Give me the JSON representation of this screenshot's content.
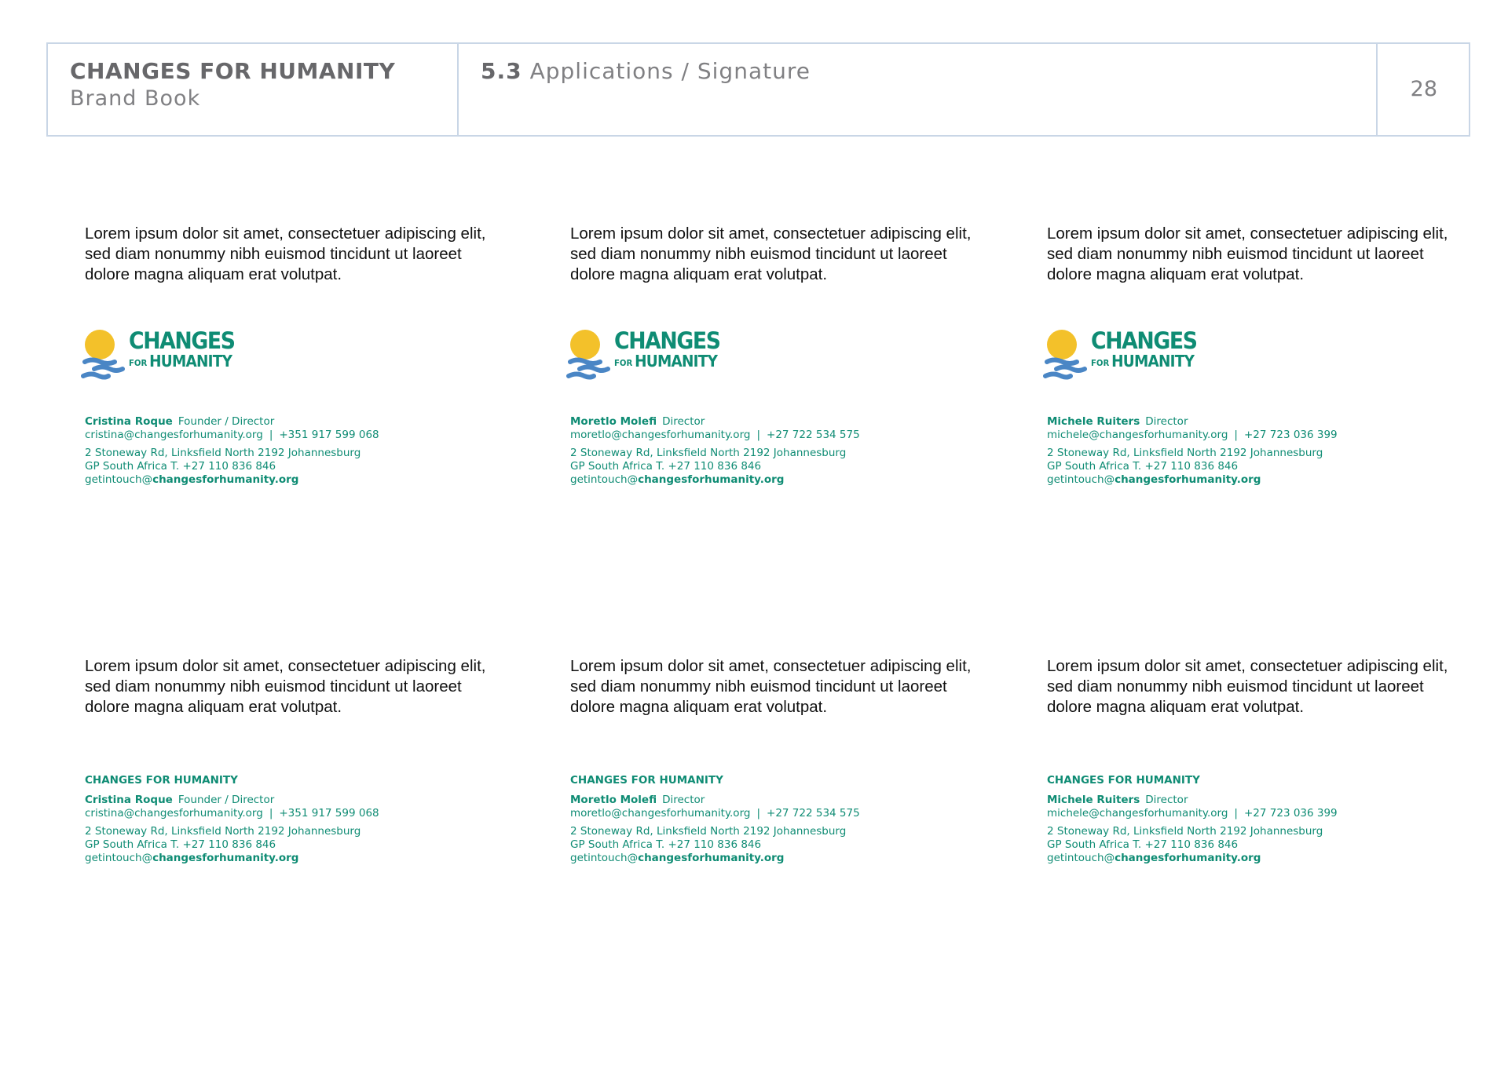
{
  "header": {
    "brand_name": "CHANGES FOR HUMANITY",
    "brand_sub": "Brand Book",
    "section_number": "5.3",
    "section_title": "Applications / Signature",
    "page_number": "28"
  },
  "logo": {
    "word_changes": "CHANGES",
    "word_for": "FOR",
    "word_humanity": "HUMANITY",
    "sun_color": "#f3c12a",
    "water_color": "#4a86c5",
    "text_color": "#0f8c74"
  },
  "lorem": "Lorem ipsum dolor sit amet, consectetuer adipiscing elit, sed diam nonummy nibh euismod tincidunt ut laoreet dolore magna aliquam erat volutpat.",
  "text_org": "CHANGES FOR HUMANITY",
  "address": {
    "line1": "2 Stoneway Rd, Linksfield North  2192 Johannesburg",
    "line2": "GP  South Africa  T. +27 110 836 846",
    "email_prefix": "getintouch@",
    "email_domain": "changesforhumanity.org"
  },
  "separator": "|",
  "people": [
    {
      "name": "Cristina Roque",
      "role": "Founder / Director",
      "email": "cristina@changesforhumanity.org",
      "phone": "+351 917 599 068"
    },
    {
      "name": "Moretlo Molefi",
      "role": "Director",
      "email": "moretlo@changesforhumanity.org",
      "phone": "+27 722 534 575"
    },
    {
      "name": "Michele Ruiters",
      "role": "Director",
      "email": "michele@changesforhumanity.org",
      "phone": "+27 723 036 399"
    }
  ]
}
